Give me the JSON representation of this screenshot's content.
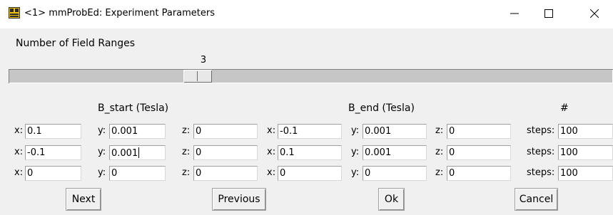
{
  "window": {
    "title": "<1> mmProbEd: Experiment Parameters",
    "controls": {
      "minimize": "—",
      "maximize": "☐",
      "close": "✕"
    }
  },
  "field_ranges": {
    "label": "Number of Field Ranges",
    "value": "3"
  },
  "headers": {
    "b_start": "B_start (Tesla)",
    "b_end": "B_end (Tesla)",
    "steps": "#"
  },
  "labels": {
    "x": "x:",
    "y": "y:",
    "z": "z:",
    "steps": "steps:"
  },
  "rows": [
    {
      "start": {
        "x": "0.1",
        "y": "0.001",
        "z": "0"
      },
      "end": {
        "x": "-0.1",
        "y": "0.001",
        "z": "0"
      },
      "steps": "100"
    },
    {
      "start": {
        "x": "-0.1",
        "y": "0.001",
        "z": "0"
      },
      "end": {
        "x": "0.1",
        "y": "0.001",
        "z": "0"
      },
      "steps": "100"
    },
    {
      "start": {
        "x": "0",
        "y": "0",
        "z": "0"
      },
      "end": {
        "x": "0",
        "y": "0",
        "z": "0"
      },
      "steps": "100"
    }
  ],
  "buttons": {
    "next": "Next",
    "previous": "Previous",
    "ok": "Ok",
    "cancel": "Cancel"
  }
}
